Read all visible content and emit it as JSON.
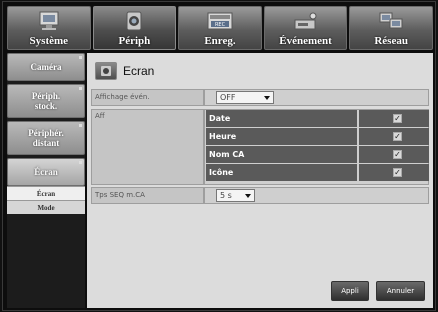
{
  "topbar": {
    "tabs": [
      {
        "label": "Système",
        "icon": "system-monitor-icon"
      },
      {
        "label": "Périph",
        "icon": "camera-device-icon"
      },
      {
        "label": "Enreg.",
        "icon": "record-rec-icon"
      },
      {
        "label": "Événement",
        "icon": "event-sensor-icon"
      },
      {
        "label": "Réseau",
        "icon": "network-icon"
      }
    ],
    "active_index": 1
  },
  "sidebar": {
    "items": [
      {
        "label": "Caméra"
      },
      {
        "label": "Périph. stock."
      },
      {
        "label": "Périphér. distant"
      },
      {
        "label": "Écran"
      }
    ],
    "subitems": [
      {
        "label": "Écran"
      },
      {
        "label": "Mode"
      }
    ]
  },
  "main": {
    "title": "Ecran",
    "affichage_even": {
      "label": "Affichage évén.",
      "value": "OFF"
    },
    "aff": {
      "label": "Aff",
      "options": [
        {
          "label": "Date",
          "checked": true
        },
        {
          "label": "Heure",
          "checked": true
        },
        {
          "label": "Nom CA",
          "checked": true
        },
        {
          "label": "Icône",
          "checked": true
        }
      ]
    },
    "tps_seq": {
      "label": "Tps SEQ m.CA",
      "value": "5 s"
    },
    "check_mark": "✓"
  },
  "buttons": {
    "apply": "Appli",
    "cancel": "Annuler"
  }
}
